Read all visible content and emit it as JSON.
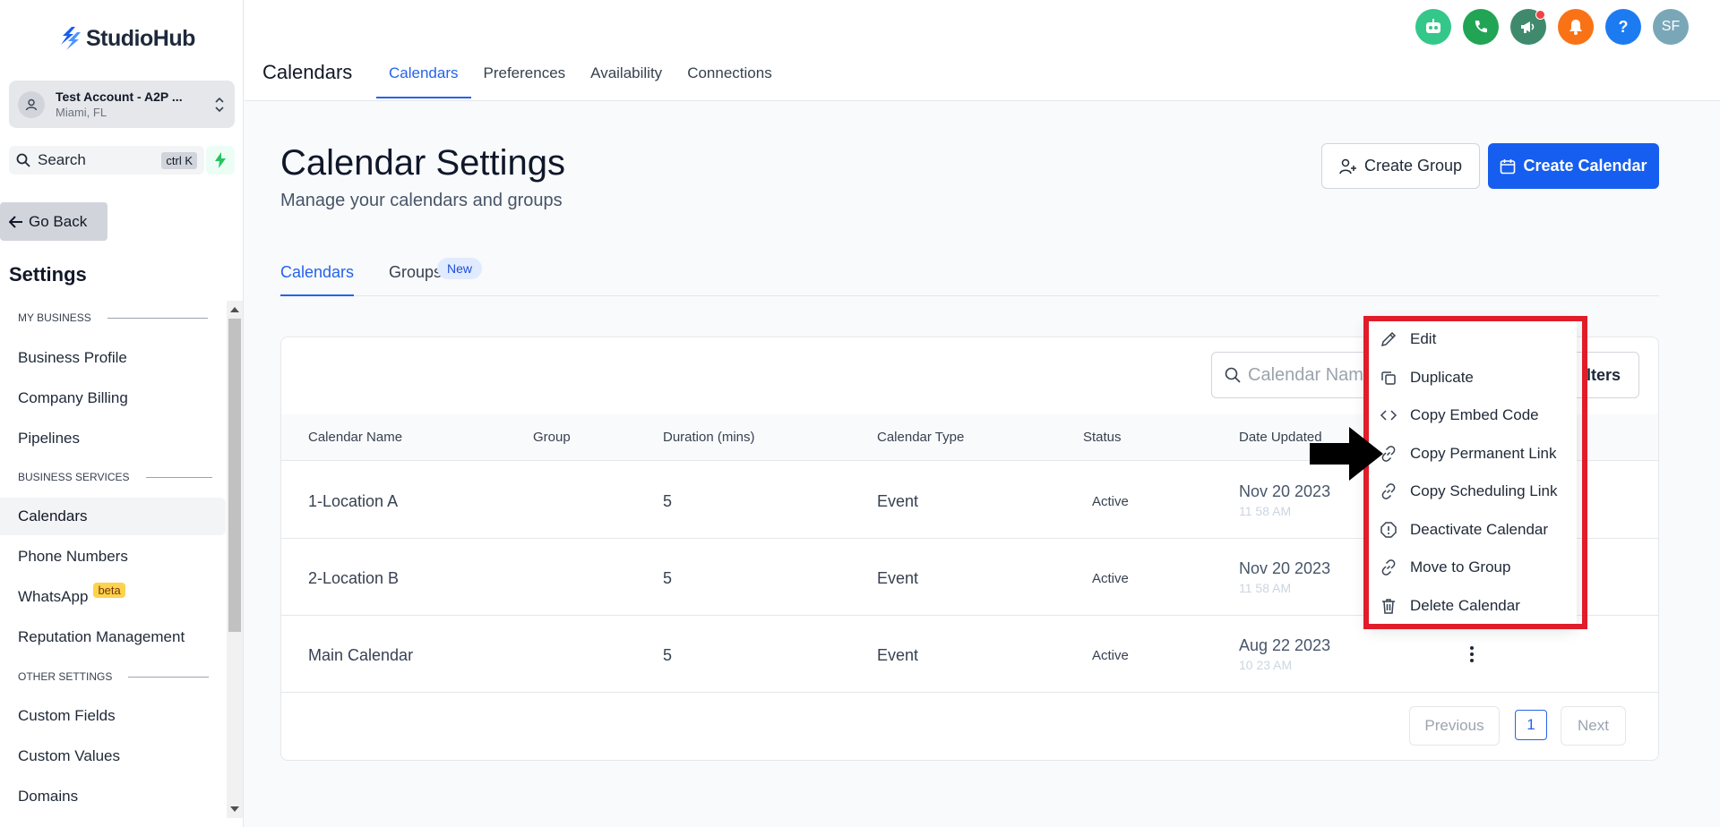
{
  "brand": {
    "name": "StudioHub"
  },
  "account": {
    "name": "Test Account - A2P ...",
    "location": "Miami, FL"
  },
  "search": {
    "label": "Search",
    "shortcut": "ctrl K"
  },
  "sidebar": {
    "go_back": "Go Back",
    "title": "Settings",
    "sections": [
      {
        "label": "MY BUSINESS"
      },
      {
        "label": "BUSINESS SERVICES"
      },
      {
        "label": "OTHER SETTINGS"
      }
    ],
    "items": [
      {
        "label": "Business Profile"
      },
      {
        "label": "Company Billing"
      },
      {
        "label": "Pipelines"
      },
      {
        "label": "Calendars"
      },
      {
        "label": "Phone Numbers"
      },
      {
        "label": "WhatsApp",
        "badge": "beta"
      },
      {
        "label": "Reputation Management"
      },
      {
        "label": "Custom Fields"
      },
      {
        "label": "Custom Values"
      },
      {
        "label": "Domains"
      }
    ],
    "active_item": "Calendars"
  },
  "header": {
    "title": "Calendars",
    "tabs": [
      {
        "label": "Calendars"
      },
      {
        "label": "Preferences"
      },
      {
        "label": "Availability"
      },
      {
        "label": "Connections"
      }
    ],
    "active_tab": "Calendars",
    "icons": [
      {
        "name": "robot-icon",
        "color": "#34c78a"
      },
      {
        "name": "phone-icon",
        "color": "#22a455"
      },
      {
        "name": "megaphone-icon",
        "color": "#3f8a6d"
      },
      {
        "name": "bell-icon",
        "color": "#f97316"
      },
      {
        "name": "help-icon",
        "color": "#1d7bf2",
        "text": "?"
      },
      {
        "name": "avatar",
        "color": "#7aa7b8",
        "text": "SF"
      }
    ]
  },
  "page": {
    "title": "Calendar Settings",
    "subtitle": "Manage your calendars and groups",
    "create_group": "Create Group",
    "create_calendar": "Create Calendar",
    "tabs": [
      {
        "label": "Calendars"
      },
      {
        "label": "Groups",
        "badge": "New"
      }
    ]
  },
  "table": {
    "search_placeholder": "Calendar Nam",
    "filters_label": "ilters",
    "columns": [
      "Calendar Name",
      "Group",
      "Duration (mins)",
      "Calendar Type",
      "Status",
      "Date Updated"
    ],
    "rows": [
      {
        "name": "1-Location A",
        "group": "",
        "duration": "5",
        "type": "Event",
        "status": "Active",
        "date": "Nov 20 2023",
        "time": "11 58 AM"
      },
      {
        "name": "2-Location B",
        "group": "",
        "duration": "5",
        "type": "Event",
        "status": "Active",
        "date": "Nov 20 2023",
        "time": "11 58 AM"
      },
      {
        "name": "Main Calendar",
        "group": "",
        "duration": "5",
        "type": "Event",
        "status": "Active",
        "date": "Aug 22 2023",
        "time": "10 23 AM"
      }
    ],
    "pagination": {
      "previous": "Previous",
      "current": "1",
      "next": "Next"
    }
  },
  "menu": {
    "items": [
      {
        "label": "Edit",
        "icon": "pencil-icon"
      },
      {
        "label": "Duplicate",
        "icon": "copy-icon"
      },
      {
        "label": "Copy Embed Code",
        "icon": "code-icon"
      },
      {
        "label": "Copy Permanent Link",
        "icon": "link-icon"
      },
      {
        "label": "Copy Scheduling Link",
        "icon": "link-icon"
      },
      {
        "label": "Deactivate Calendar",
        "icon": "alert-octagon-icon"
      },
      {
        "label": "Move to Group",
        "icon": "link-icon"
      },
      {
        "label": "Delete Calendar",
        "icon": "trash-icon"
      }
    ],
    "highlight_color": "#e11d2a"
  }
}
